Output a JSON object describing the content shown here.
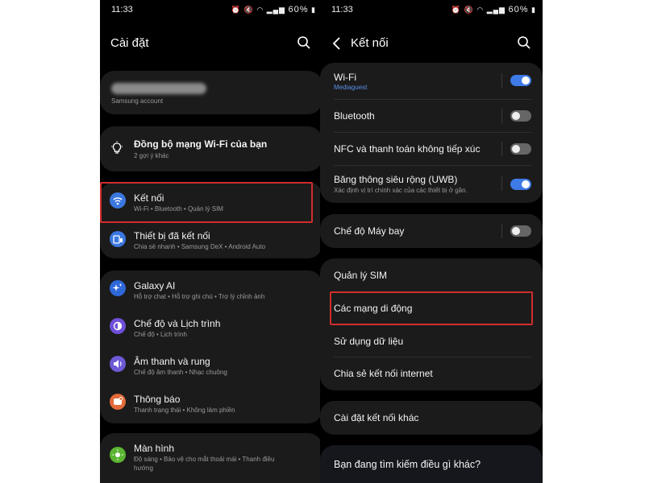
{
  "colors": {
    "accent": "#3e7be6",
    "highlight": "#d12d2d",
    "card": "#1b1b1b",
    "background": "#000000"
  },
  "status_bar": {
    "time": "11:33",
    "battery": "60%",
    "icons": [
      "alarm-icon",
      "mute-icon",
      "wifi-icon",
      "signal-icon"
    ]
  },
  "left": {
    "title": "Cài đặt",
    "account": {
      "name": "",
      "subtitle": "Samsung account"
    },
    "suggestion": {
      "title": "Đồng bộ mạng Wi-Fi của bạn",
      "subtitle": "2 gợi ý khác"
    },
    "items": [
      {
        "icon": "wifi-icon",
        "color": "#3b77e0",
        "title": "Kết nối",
        "subtitle": "Wi-Fi  •  Bluetooth  •  Quản lý SIM"
      },
      {
        "icon": "devices-icon",
        "color": "#3b77e0",
        "title": "Thiết bị đã kết nối",
        "subtitle": "Chia sẻ nhanh  •  Samsung DeX  •  Android Auto"
      },
      {
        "icon": "galaxy-ai-icon",
        "color": "#2f68d8",
        "title": "Galaxy AI",
        "subtitle": "Hỗ trợ chat  •  Hỗ trợ ghi chú  •  Trợ lý chỉnh ảnh"
      },
      {
        "icon": "modes-icon",
        "color": "#6f4fd8",
        "title": "Chế độ và Lịch trình",
        "subtitle": "Chế độ  •  Lịch trình"
      },
      {
        "icon": "sound-icon",
        "color": "#6c5ad6",
        "title": "Âm thanh và rung",
        "subtitle": "Chế độ âm thanh  •  Nhạc chuông"
      },
      {
        "icon": "notification-icon",
        "color": "#e26a3a",
        "title": "Thông báo",
        "subtitle": "Thanh trạng thái  •  Không làm phiền"
      },
      {
        "icon": "display-icon",
        "color": "#5bb532",
        "title": "Màn hình",
        "subtitle": "Độ sáng  •  Bảo vệ cho mắt thoải mái  •  Thanh điều",
        "subtitle2": "hướng"
      }
    ]
  },
  "right": {
    "title": "Kết nối",
    "toggles": [
      {
        "title": "Wi-Fi",
        "subtitle": "Mediaguest",
        "on": true
      },
      {
        "title": "Bluetooth",
        "subtitle": "",
        "on": false
      },
      {
        "title": "NFC và thanh toán không tiếp xúc",
        "subtitle": "",
        "on": false
      },
      {
        "title": "Băng thông siêu rộng (UWB)",
        "subtitle": "Xác định vị trí chính xác của các thiết bị ở gần.",
        "on": true
      }
    ],
    "airplane": {
      "title": "Chế độ Máy bay",
      "on": false
    },
    "menu": [
      "Quản lý SIM",
      "Các mạng di động",
      "Sử dụng dữ liệu",
      "Chia sẻ kết nối internet"
    ],
    "more": "Cài đặt kết nối khác",
    "looking": "Bạn đang tìm kiếm điều gì khác?"
  }
}
